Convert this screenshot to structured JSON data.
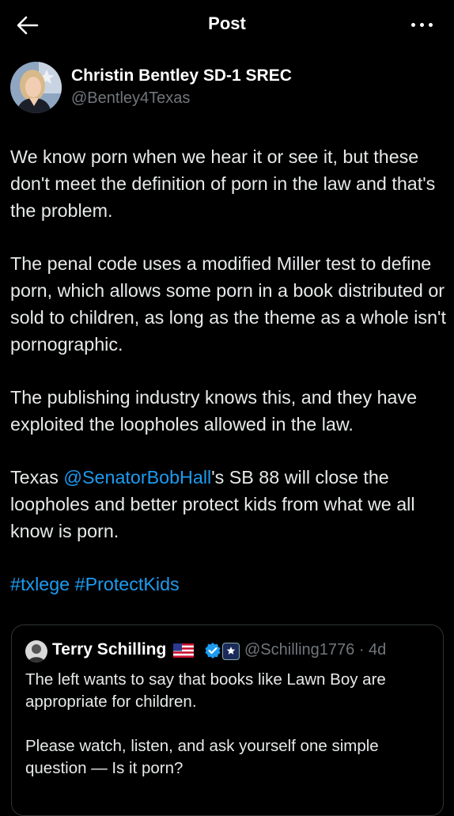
{
  "header": {
    "title": "Post"
  },
  "author": {
    "name": "Christin Bentley SD-1 SREC",
    "handle": "@Bentley4Texas"
  },
  "tweet": {
    "p1": "We know porn when we hear it or see it, but these don't meet the definition of porn in the law and that's the problem.",
    "p2": "The penal code uses a modified Miller test to define porn, which allows some porn in a book distributed or sold to children, as long as the theme as a whole isn't pornographic.",
    "p3": "The publishing industry knows this, and they have exploited the loopholes allowed in the law.",
    "p4_pre": "Texas ",
    "p4_mention": "@SenatorBobHall",
    "p4_post": "'s  SB 88 will close the loopholes and better protect kids from what we all know is porn.",
    "hashtag1": "#txlege",
    "hashtag2": "#ProtectKids"
  },
  "quote": {
    "name": "Terry Schilling",
    "handle_time": "@Schilling1776 · 4d",
    "p1": "The left wants to say that books like Lawn Boy are appropriate for children.",
    "p2": "Please watch, listen, and ask yourself one simple question — Is it porn?"
  },
  "icons": {
    "back": "arrow-left-icon",
    "more": "more-horizontal-icon",
    "verified": "verified-badge-icon",
    "flag": "us-flag-icon"
  },
  "colors": {
    "background": "#000000",
    "text": "#e7e9ea",
    "secondary": "#71767b",
    "link": "#1d9bf0",
    "border": "#2f3336"
  }
}
